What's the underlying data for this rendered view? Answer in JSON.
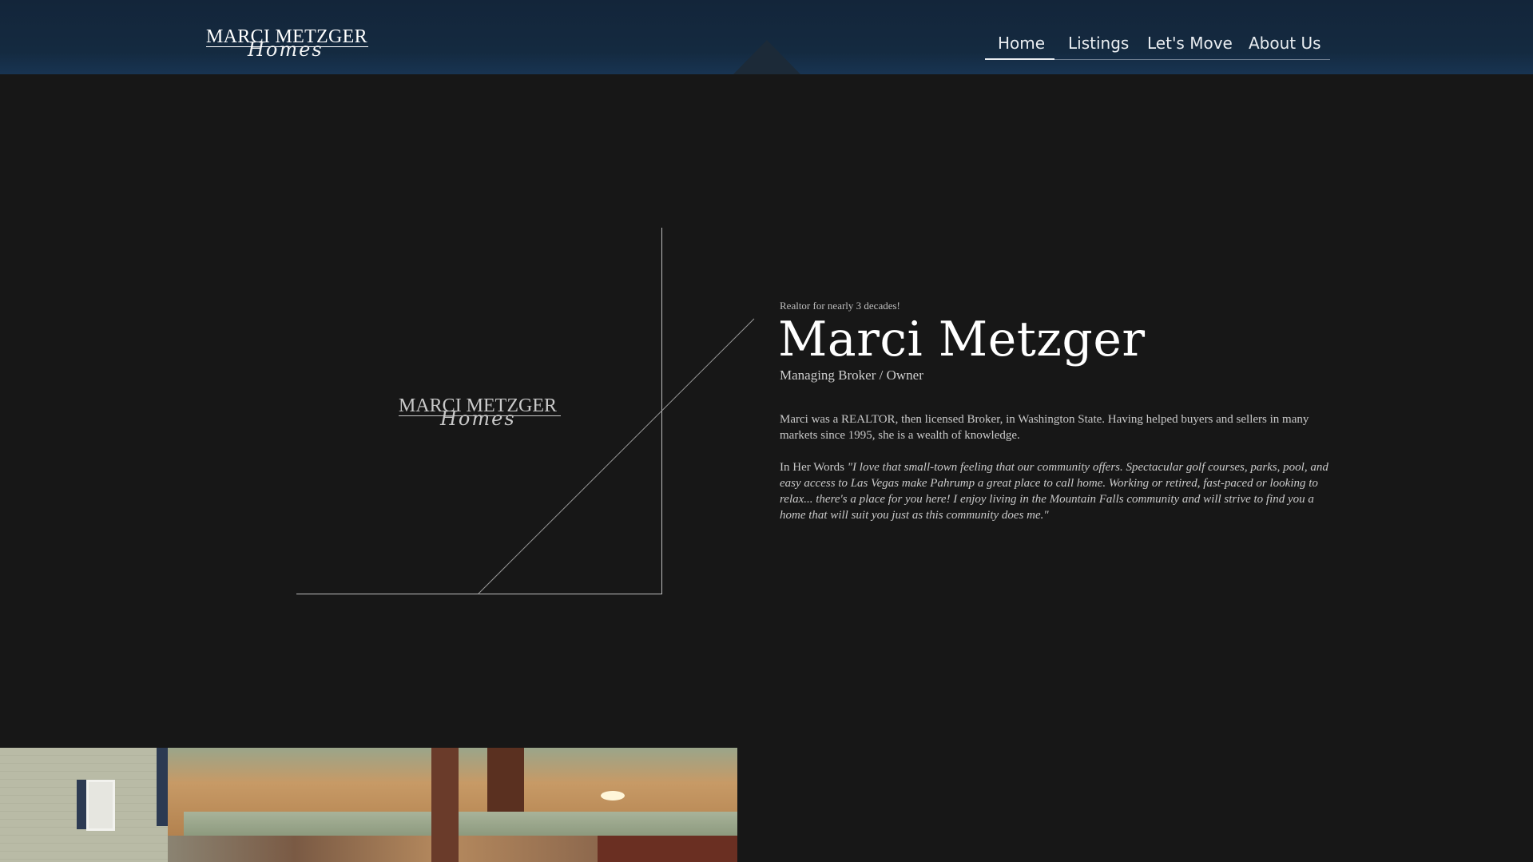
{
  "brand": {
    "logo_main": "MARCI METZGER",
    "logo_script": "Homes"
  },
  "nav": {
    "items": [
      {
        "label": "Home",
        "active": true
      },
      {
        "label": "Listings",
        "active": false
      },
      {
        "label": "Let's Move",
        "active": false
      },
      {
        "label": "About Us",
        "active": false
      }
    ]
  },
  "hero": {
    "eyebrow": "Realtor for nearly 3 decades!",
    "name": "Marci Metzger",
    "role": "Managing Broker / Owner",
    "bio": "Marci was a REALTOR, then licensed Broker, in Washington State. Having helped buyers and sellers in many markets since 1995, she is a wealth of knowledge.",
    "quote_lead": "In Her Words ",
    "quote_text": "\"I love that small-town feeling that our community offers. Spectacular golf courses, parks, pool, and easy access to Las Vegas make Pahrump a great place to call home. Working or retired, fast-paced or looking to relax... there's a place for you here! I enjoy living in the Mountain Falls community and will strive to find you a home that will suit you just as this community does me.\""
  },
  "colors": {
    "header_bg": "#13253a",
    "page_bg": "#171717",
    "text_primary": "#ffffff",
    "text_muted": "#c9c9c9",
    "line": "#bdbdbd"
  }
}
